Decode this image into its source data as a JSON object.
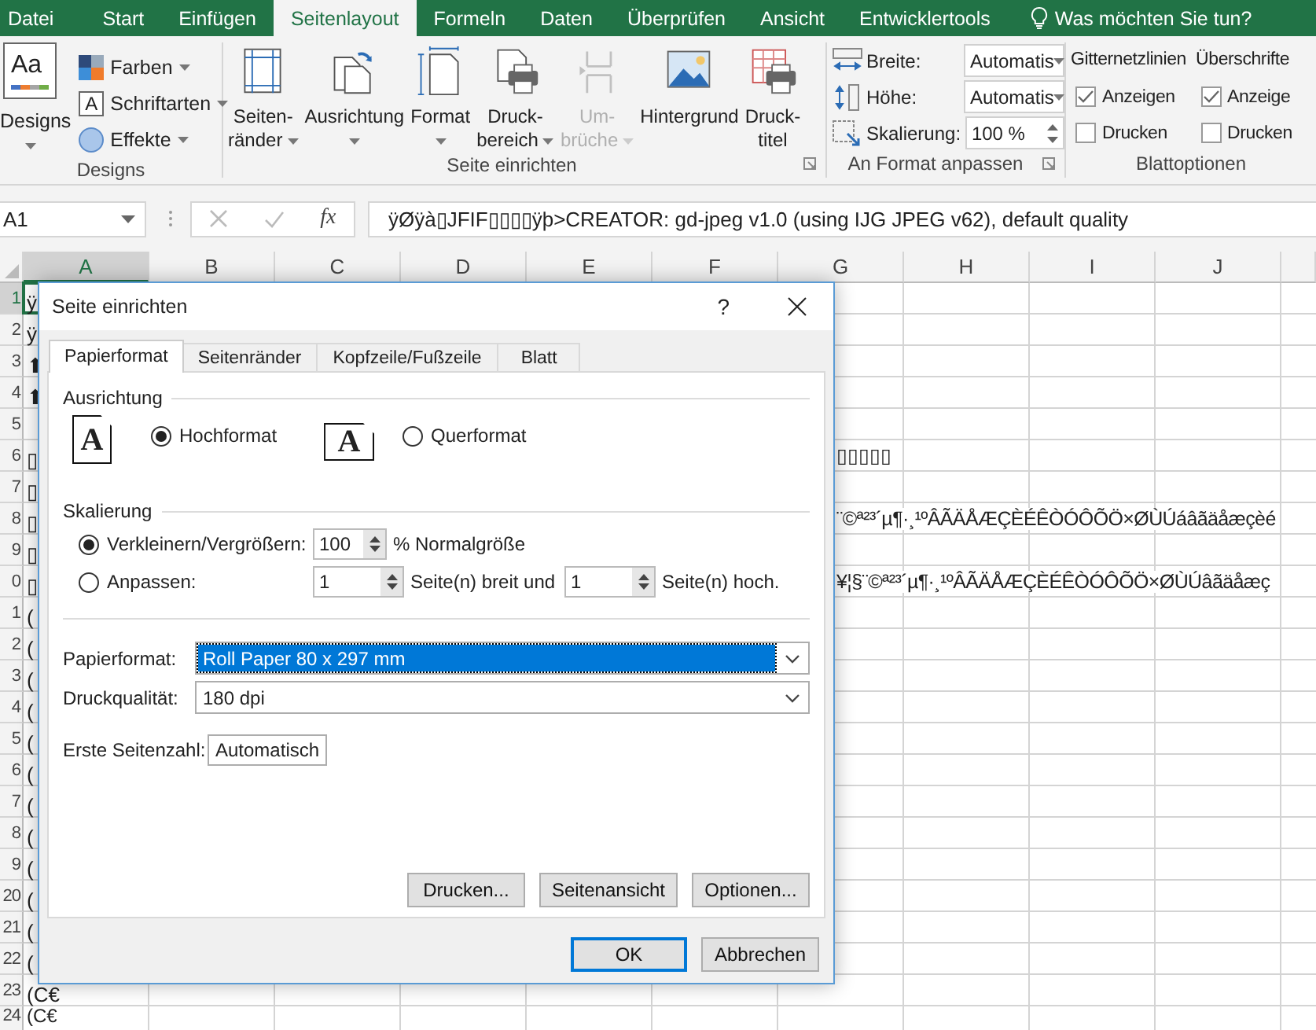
{
  "ribbon_tabs": [
    {
      "label": "Datei",
      "selected": false
    },
    {
      "label": "Start",
      "selected": false
    },
    {
      "label": "Einfügen",
      "selected": false
    },
    {
      "label": "Seitenlayout",
      "selected": true
    },
    {
      "label": "Formeln",
      "selected": false
    },
    {
      "label": "Daten",
      "selected": false
    },
    {
      "label": "Überprüfen",
      "selected": false
    },
    {
      "label": "Ansicht",
      "selected": false
    },
    {
      "label": "Entwicklertools",
      "selected": false
    }
  ],
  "tell_me": {
    "placeholder": "Was möchten Sie tun?"
  },
  "designs_group": {
    "label": "Designs",
    "big_button": {
      "label": "Designs",
      "icon_text": "Aa"
    },
    "items": [
      {
        "label": "Farben",
        "kind": "colors"
      },
      {
        "label": "Schriftarten",
        "kind": "fonts",
        "icon_text": "A"
      },
      {
        "label": "Effekte",
        "kind": "effects"
      }
    ]
  },
  "page_setup_group": {
    "label": "Seite einrichten",
    "buttons": [
      {
        "kind": "margins",
        "lines": [
          "Seiten-",
          "ränder"
        ],
        "dropdown": true,
        "disabled": false
      },
      {
        "kind": "orientation",
        "lines": [
          "Ausrichtung"
        ],
        "dropdown": true,
        "disabled": false
      },
      {
        "kind": "size",
        "lines": [
          "Format"
        ],
        "dropdown": true,
        "disabled": false
      },
      {
        "kind": "print_area",
        "lines": [
          "Druck-",
          "bereich"
        ],
        "dropdown": true,
        "disabled": false
      },
      {
        "kind": "breaks",
        "lines": [
          "Um-",
          "brüche"
        ],
        "dropdown": true,
        "disabled": true
      },
      {
        "kind": "background",
        "lines": [
          "Hintergrund"
        ],
        "dropdown": false,
        "disabled": false
      },
      {
        "kind": "print_titles",
        "lines": [
          "Druck-",
          "titel"
        ],
        "dropdown": false,
        "disabled": false
      }
    ]
  },
  "scale_group": {
    "label": "An Format anpassen",
    "fields": [
      {
        "kind": "dropdown",
        "label": "Breite:",
        "value": "Automatis"
      },
      {
        "kind": "dropdown",
        "label": "Höhe:",
        "value": "Automatis"
      },
      {
        "kind": "spinner",
        "label": "Skalierung:",
        "value": "100 %"
      }
    ]
  },
  "sheet_options_group": {
    "label": "Blattoptionen",
    "columns": [
      {
        "heading": "Gitternetzlinien",
        "options": [
          {
            "label": "Anzeigen",
            "checked": true
          },
          {
            "label": "Drucken",
            "checked": false
          }
        ]
      },
      {
        "heading": "Überschrifte",
        "options": [
          {
            "label": "Anzeige",
            "checked": true
          },
          {
            "label": "Drucken",
            "checked": false
          }
        ]
      }
    ]
  },
  "formula_bar": {
    "name_box": "A1",
    "function_label": "fx",
    "formula": "ÿØÿà▯JFIF▯▯▯▯ÿþ>CREATOR: gd-jpeg v1.0 (using IJG JPEG v62), default quality"
  },
  "sheet": {
    "columns": [
      {
        "label": "A",
        "selected": true
      },
      {
        "label": "B",
        "selected": false
      },
      {
        "label": "C",
        "selected": false
      },
      {
        "label": "D",
        "selected": false
      },
      {
        "label": "E",
        "selected": false
      },
      {
        "label": "F",
        "selected": false
      },
      {
        "label": "G",
        "selected": false
      },
      {
        "label": "H",
        "selected": false
      },
      {
        "label": "I",
        "selected": false
      },
      {
        "label": "J",
        "selected": false
      }
    ],
    "rows": [
      {
        "header": "1",
        "selected": true,
        "column_a": "ÿ"
      },
      {
        "header": "2",
        "selected": false,
        "column_a": "ÿ"
      },
      {
        "header": "3",
        "selected": false,
        "column_a": "⬆"
      },
      {
        "header": "4",
        "selected": false,
        "column_a": "⬆"
      },
      {
        "header": "5",
        "selected": false
      },
      {
        "header": "6",
        "selected": false,
        "column_a": "▯",
        "column_g": "▯▯▯▯▯"
      },
      {
        "header": "7",
        "selected": false,
        "column_a": "▯"
      },
      {
        "header": "8",
        "selected": false,
        "column_a": "▯",
        "column_g": "¨©ª²³´µ¶·¸¹ºÂÃÄÅÆÇÈÉÊÒÓÔÕÖ×ØÙÚáâãäåæçèé"
      },
      {
        "header": "9",
        "selected": false,
        "column_a": "▯"
      },
      {
        "header": "0",
        "selected": false,
        "column_a": "▯",
        "column_g": "¥¦§¨©ª²³´µ¶·¸¹ºÂÃÄÅÆÇÈÉÊÒÓÔÕÖ×ØÙÚâãäåæç"
      },
      {
        "header": "1",
        "selected": false,
        "column_a": "("
      },
      {
        "header": "2",
        "selected": false,
        "column_a": "("
      },
      {
        "header": "3",
        "selected": false,
        "column_a": "("
      },
      {
        "header": "4",
        "selected": false,
        "column_a": "("
      },
      {
        "header": "5",
        "selected": false,
        "column_a": "("
      },
      {
        "header": "6",
        "selected": false,
        "column_a": "("
      },
      {
        "header": "7",
        "selected": false,
        "column_a": "("
      },
      {
        "header": "8",
        "selected": false,
        "column_a": "("
      },
      {
        "header": "9",
        "selected": false,
        "column_a": "("
      },
      {
        "header": "20",
        "selected": false,
        "column_a": "("
      },
      {
        "header": "21",
        "selected": false,
        "column_a": "("
      },
      {
        "header": "22",
        "selected": false,
        "column_a": "("
      },
      {
        "header": "23",
        "selected": false,
        "column_a": "(C€"
      },
      {
        "header": "24",
        "selected": false,
        "column_a": "(C€"
      }
    ]
  },
  "dialog": {
    "title": "Seite einrichten",
    "help": "?",
    "tabs": [
      {
        "label": "Papierformat",
        "selected": true
      },
      {
        "label": "Seitenränder",
        "selected": false
      },
      {
        "label": "Kopfzeile/Fußzeile",
        "selected": false
      },
      {
        "label": "Blatt",
        "selected": false
      }
    ],
    "orientation": {
      "heading": "Ausrichtung",
      "options": [
        {
          "kind": "portrait",
          "glyph": "A",
          "label": "Hochformat",
          "selected": true
        },
        {
          "kind": "landscape",
          "glyph": "A",
          "label": "Querformat",
          "selected": false
        }
      ]
    },
    "scaling": {
      "heading": "Skalierung",
      "options": [
        {
          "kind": "percent",
          "label": "Verkleinern/Vergrößern:",
          "selected": true,
          "value": "100",
          "suffix": "% Normalgröße"
        },
        {
          "kind": "fit",
          "label": "Anpassen:",
          "selected": false,
          "wide_value": "1",
          "wide_suffix": "Seite(n) breit und",
          "tall_value": "1",
          "tall_suffix": "Seite(n) hoch."
        }
      ]
    },
    "paper_size": {
      "label": "Papierformat:",
      "value": "Roll Paper 80 x 297 mm",
      "highlighted": true
    },
    "print_quality": {
      "label": "Druckqualität:",
      "value": "180 dpi",
      "highlighted": false
    },
    "first_page": {
      "label": "Erste Seitenzahl:",
      "value": "Automatisch"
    },
    "panel_buttons": [
      "Drucken...",
      "Seitenansicht",
      "Optionen..."
    ],
    "buttons": [
      {
        "label": "OK",
        "default": true
      },
      {
        "label": "Abbrechen",
        "default": false
      }
    ]
  }
}
